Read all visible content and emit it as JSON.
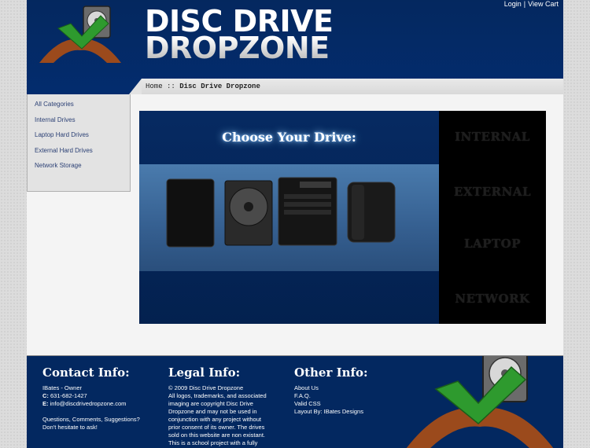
{
  "header": {
    "login_label": "Login",
    "separator": "|",
    "cart_label": "View Cart",
    "title_line1": "DISC DRIVE",
    "title_line2": "DROPZONE"
  },
  "breadcrumb": {
    "home": "Home",
    "separator": "::",
    "current": "Disc Drive Dropzone"
  },
  "sidebar": {
    "items": [
      {
        "label": "All Categories"
      },
      {
        "label": "Internal Drives"
      },
      {
        "label": "Laptop Hard Drives"
      },
      {
        "label": "External Hard Drives"
      },
      {
        "label": "Network Storage"
      }
    ]
  },
  "banner": {
    "title": "Choose Your Drive:",
    "links": [
      "INTERNAL",
      "EXTERNAL",
      "LAPTOP",
      "NETWORK"
    ]
  },
  "footer": {
    "contact": {
      "heading": "Contact Info:",
      "owner": "IBates - Owner",
      "phone_label": "C:",
      "phone": "631-682-1427",
      "email_label": "E:",
      "email": "info@discdrivedropzone.com",
      "note1": "Questions, Comments, Suggestions?",
      "note2": "Don't hesitate to ask!"
    },
    "legal": {
      "heading": "Legal Info:",
      "lines": [
        "© 2009 Disc Drive Dropzone",
        "All logos, trademarks, and associated",
        "imaging are copyright Disc Drive",
        "Dropzone and may not be used in",
        "conjunction with any project without",
        "prior consent of its owner. The drives",
        "sold on this website are non existant.",
        "This is a school project with a fully"
      ]
    },
    "other": {
      "heading": "Other Info:",
      "links": [
        "About Us",
        "F.A.Q.",
        "Valid CSS",
        "Layout By: IBates Designs"
      ]
    }
  },
  "colors": {
    "header_blue": "#032c6e",
    "footer_blue": "#032860",
    "logo_green": "#2e9a2e",
    "logo_brown": "#9b4a1c"
  }
}
